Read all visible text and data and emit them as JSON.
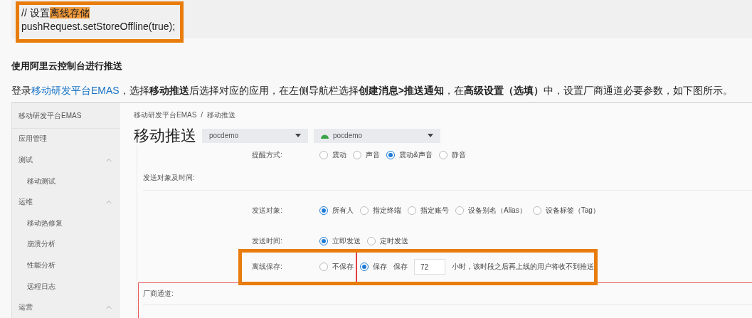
{
  "code_block": {
    "lines": [
      {
        "parts": [
          {
            "text": "// 设置",
            "highlighted": false
          },
          {
            "text": "离线存储",
            "highlighted": true
          }
        ]
      },
      {
        "parts": [
          {
            "text": "pushRequest.setStoreOffline(true);",
            "highlighted": false
          }
        ]
      }
    ]
  },
  "heading": "使用阿里云控制台进行推送",
  "paragraph": {
    "prefix": "登录",
    "link": "移动研发平台EMAS",
    "rest": "，选择**移动推送**后选择对应的应用，在左侧导航栏选择**创建消息>推送通知**，在**高级设置（选填）**中，设置厂商通道必要参数，如下图所示。"
  },
  "console": {
    "sidebar": {
      "title": "移动研发平台EMAS",
      "items": [
        {
          "label": "应用管理"
        },
        {
          "label": "测试",
          "expanded": true,
          "children": [
            {
              "label": "移动测试"
            }
          ]
        },
        {
          "label": "运维",
          "expanded": true,
          "children": [
            {
              "label": "移动热修复"
            },
            {
              "label": "崩溃分析"
            },
            {
              "label": "性能分析"
            },
            {
              "label": "远程日志"
            }
          ]
        },
        {
          "label": "运营",
          "expanded": true
        }
      ]
    },
    "breadcrumb": [
      "移动研发平台EMAS",
      "移动推送"
    ],
    "breadcrumb_separator": "/",
    "title": "移动推送",
    "dropdowns": [
      {
        "kind": "plain",
        "value": "pocdemo"
      },
      {
        "kind": "android",
        "value": "pocdemo"
      }
    ],
    "reminder": {
      "label": "提醒方式:",
      "options": [
        {
          "label": "震动",
          "selected": false
        },
        {
          "label": "声音",
          "selected": false
        },
        {
          "label": "震动&声音",
          "selected": true
        },
        {
          "label": "静音",
          "selected": false
        }
      ]
    },
    "section_title": "发送对象及时间:",
    "target": {
      "label": "发送对象:",
      "options": [
        {
          "label": "所有人",
          "selected": true
        },
        {
          "label": "指定终端",
          "selected": false
        },
        {
          "label": "指定账号",
          "selected": false
        },
        {
          "label": "设备别名（Alias）",
          "selected": false
        },
        {
          "label": "设备标签（Tag）",
          "selected": false
        }
      ]
    },
    "send_time": {
      "label": "发送时间:",
      "options": [
        {
          "label": "立即发送",
          "selected": true
        },
        {
          "label": "定时发送",
          "selected": false
        }
      ]
    },
    "offline": {
      "label": "离线保存:",
      "options": [
        {
          "label": "不保存",
          "selected": false
        },
        {
          "label": "保存",
          "selected": true
        }
      ],
      "retention_label": "保存",
      "hours": "72",
      "note": "小时，该时段之后再上线的用户将收不到推送"
    },
    "vendor_section": {
      "title": "厂商通道:"
    }
  }
}
